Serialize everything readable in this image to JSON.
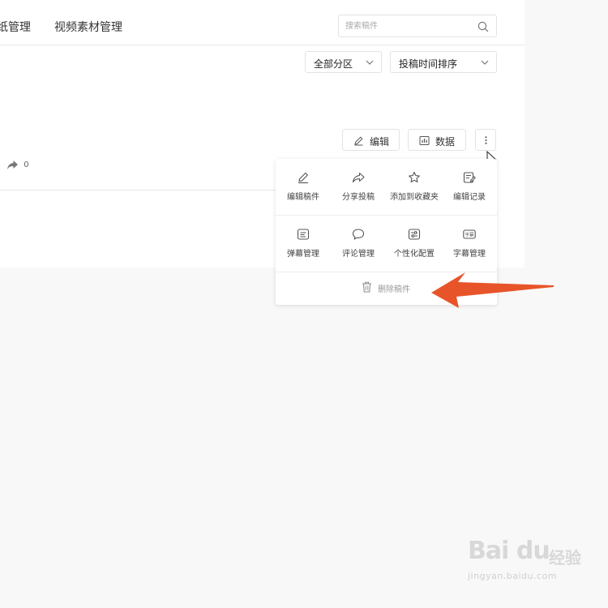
{
  "nav": {
    "tabs": [
      {
        "label": "纸管理"
      },
      {
        "label": "视频素材管理"
      }
    ],
    "search": {
      "placeholder": "搜索稿件"
    }
  },
  "filters": {
    "area_label": "全部分区",
    "sort_label": "投稿时间排序"
  },
  "actions": {
    "edit_label": "编辑",
    "data_label": "数据"
  },
  "stats": {
    "share_count": "0"
  },
  "more_menu": {
    "items": [
      {
        "label": "编辑稿件",
        "icon": "pencil-icon"
      },
      {
        "label": "分享投稿",
        "icon": "share-icon"
      },
      {
        "label": "添加到收藏夹",
        "icon": "star-icon"
      },
      {
        "label": "编辑记录",
        "icon": "edit-record-icon"
      },
      {
        "label": "弹幕管理",
        "icon": "danmaku-icon"
      },
      {
        "label": "评论管理",
        "icon": "comment-icon"
      },
      {
        "label": "个性化配置",
        "icon": "settings-sliders-icon"
      },
      {
        "label": "字幕管理",
        "icon": "subtitle-icon"
      }
    ],
    "delete_label": "删除稿件",
    "subtitle_icon_text": "字幕"
  },
  "annotation": {
    "arrow_color": "#e8542a"
  },
  "watermark": {
    "logo": "Bai du",
    "cn": "经验",
    "url": "jingyan.baidu.com"
  }
}
